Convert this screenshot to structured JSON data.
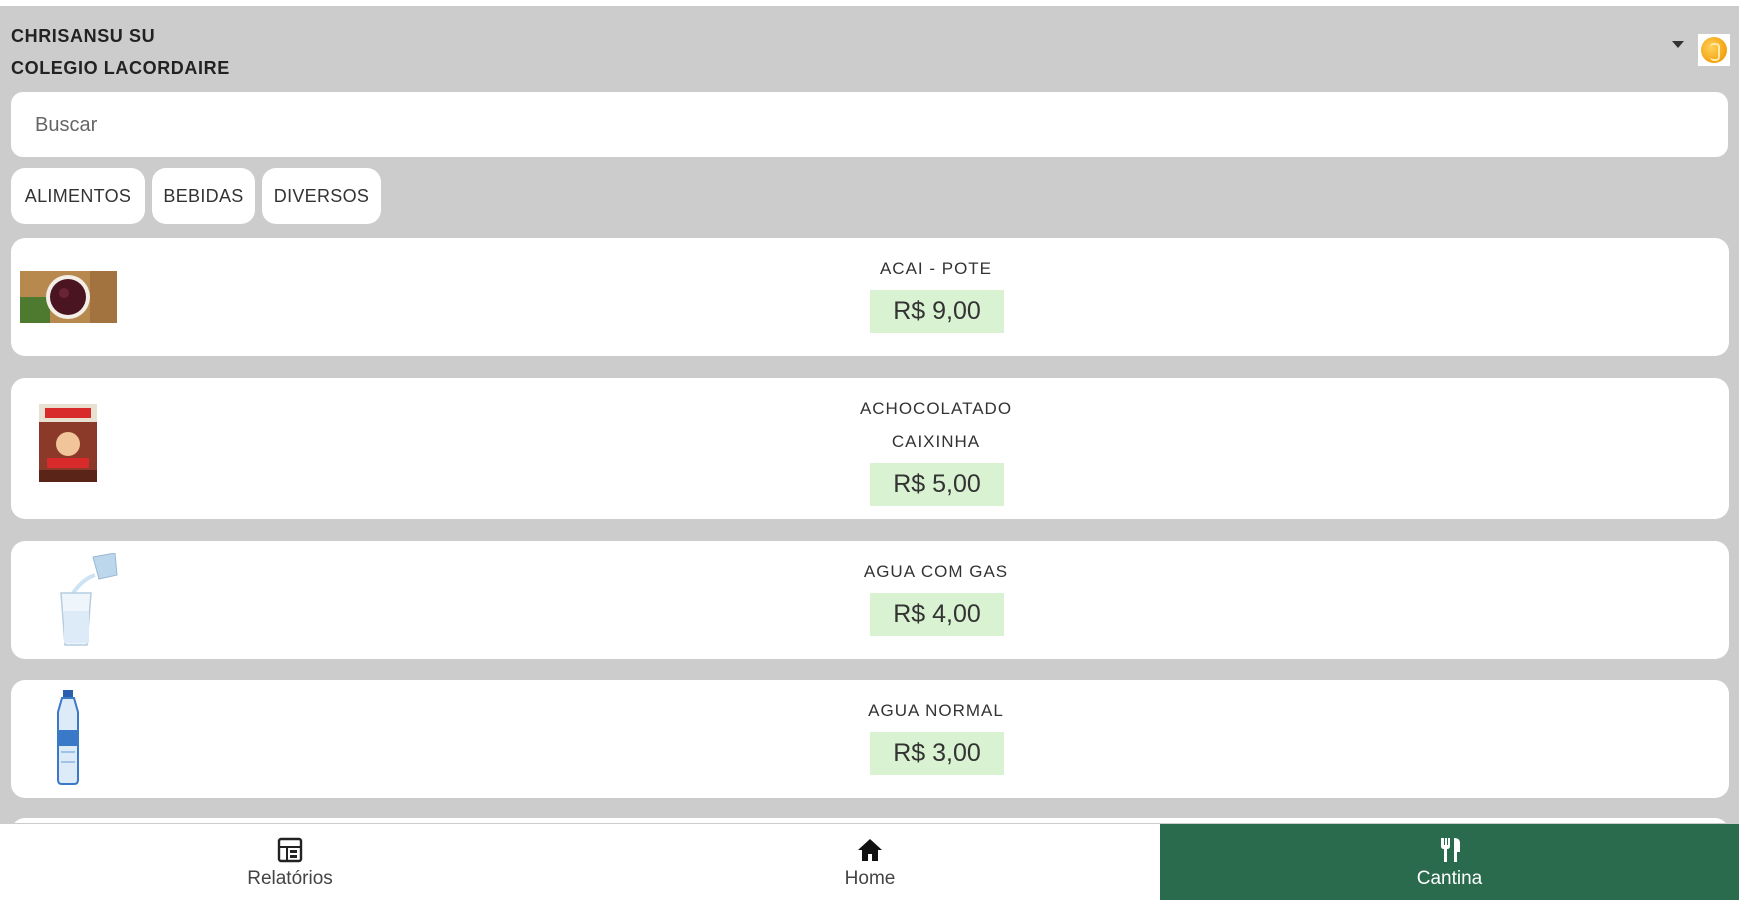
{
  "header": {
    "user_name": "CHRISANSU SU",
    "school_name": "COLEGIO LACORDAIRE",
    "coin_icon": "coin-icon",
    "dropdown_icon": "caret-down-icon"
  },
  "search": {
    "placeholder": "Buscar",
    "value": ""
  },
  "categories": [
    {
      "label": "ALIMENTOS"
    },
    {
      "label": "BEBIDAS"
    },
    {
      "label": "DIVERSOS"
    }
  ],
  "products": [
    {
      "name": "ACAI - POTE",
      "price": "R$ 9,00",
      "image": "acai-bowl"
    },
    {
      "name_line1": "ACHOCOLATADO",
      "name_line2": "CAIXINHA",
      "price": "R$ 5,00",
      "image": "chocolate-milk-box"
    },
    {
      "name": "AGUA COM GAS",
      "price": "R$ 4,00",
      "image": "sparkling-water-glass"
    },
    {
      "name": "AGUA NORMAL",
      "price": "R$ 3,00",
      "image": "water-bottle"
    }
  ],
  "nav": {
    "tabs": [
      {
        "label": "Relatórios",
        "icon": "report-icon"
      },
      {
        "label": "Home",
        "icon": "home-icon"
      },
      {
        "label": "Cantina",
        "icon": "cutlery-icon",
        "active": true
      }
    ]
  },
  "colors": {
    "background": "#cccccc",
    "price_badge": "#d9f2d2",
    "active_tab": "#2a6a4d"
  }
}
